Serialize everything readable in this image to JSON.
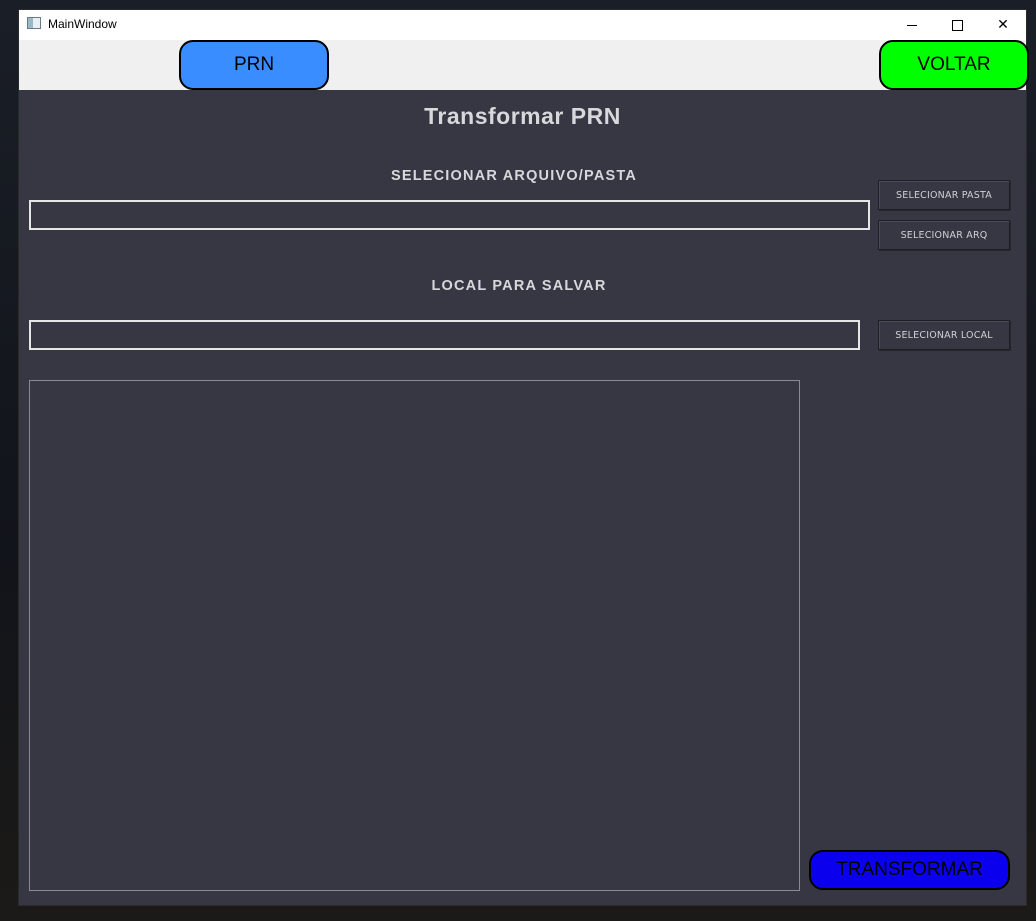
{
  "window": {
    "title": "MainWindow",
    "controls": {
      "minimize_icon": "minimize-icon",
      "maximize_icon": "maximize-icon",
      "close_icon": "close-icon",
      "close_glyph": "✕"
    }
  },
  "toolbar": {
    "prn_label": "PRN",
    "voltar_label": "VOLTAR",
    "prn_color": "#3a8dff",
    "voltar_color": "#00ff00"
  },
  "main": {
    "title": "Transformar PRN",
    "source": {
      "label": "SELECIONAR ARQUIVO/PASTA",
      "value": "",
      "select_folder_label": "SELECIONAR PASTA",
      "select_file_label": "SELECIONAR ARQ"
    },
    "destination": {
      "label": "LOCAL PARA SALVAR",
      "value": "",
      "select_local_label": "SELECIONAR LOCAL"
    },
    "log": {
      "value": ""
    },
    "transform_label": "TRANSFORMAR",
    "transform_color": "#0a00ee",
    "background_color": "#363742"
  }
}
